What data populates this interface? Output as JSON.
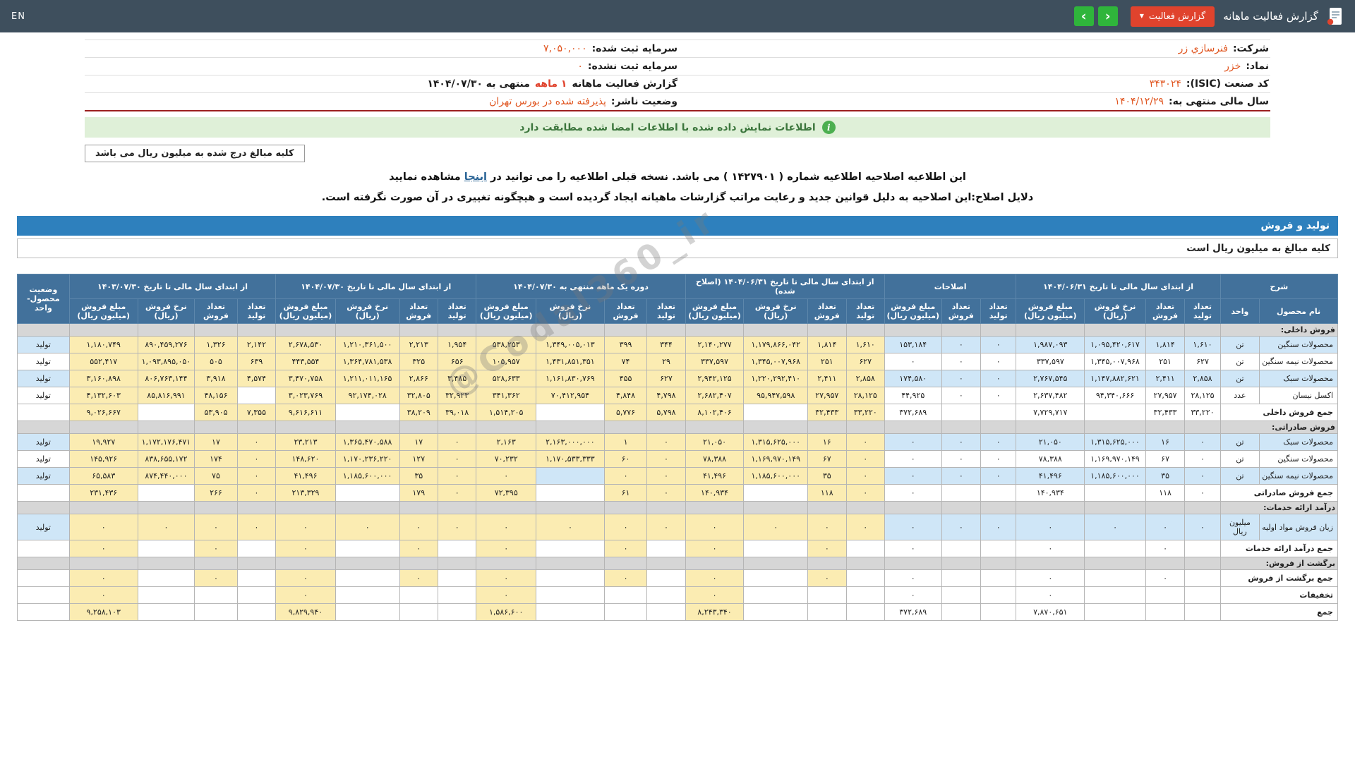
{
  "topbar": {
    "title": "گزارش فعالیت ماهانه",
    "report_button": "گزارش فعالیت",
    "nav_prev": "‹",
    "nav_next": "›",
    "lang": "EN"
  },
  "info": {
    "company_label": "شرکت:",
    "company": "فنرسازي زر",
    "symbol_label": "نماد:",
    "symbol": "خزر",
    "isic_label": "کد صنعت (ISIC):",
    "isic": "۳۴۳۰۲۴",
    "fiscal_label": "سال مالی منتهی به:",
    "fiscal": "۱۴۰۴/۱۲/۲۹",
    "cap_reg_label": "سرمایه ثبت شده:",
    "cap_reg": "۷,۰۵۰,۰۰۰",
    "cap_unreg_label": "سرمایه ثبت نشده:",
    "cap_unreg": "۰",
    "period_prefix": "گزارش فعالیت ماهانه",
    "period_highlight": "۱ ماهه",
    "period_suffix": "منتهی به ۱۴۰۴/۰۷/۳۰",
    "status_label": "وضعیت ناشر:",
    "status": "پذیرفته شده در بورس تهران"
  },
  "banner": {
    "text": "اطلاعات نمایش داده شده با اطلاعات امضا شده مطابقت دارد"
  },
  "amounts_note": "کلیه مبالغ درج شده به میلیون ریال می باشد",
  "notice": {
    "line1_a": "این اطلاعیه اصلاحیه اطلاعیه شماره ( ۱۴۲۷۹۰۱ ) می باشد. نسخه قبلی اطلاعیه را می توانید در",
    "line1_link": "اینجا",
    "line1_b": "مشاهده نمایید",
    "line2": "دلایل اصلاح:این اصلاحیه به دلیل قوانین جدید و رعایت مراتب گزارشات ماهیانه ایجاد گردیده است و هیچگونه تغییری در آن صورت نگرفته است."
  },
  "section_bar": "تولید و فروش",
  "table_note": "کلیه مبالغ به میلیون ریال است",
  "watermark": "@Codal360_ir",
  "table": {
    "desc_header": "شرح",
    "name_header": "نام محصول",
    "unit_header": "واحد",
    "status_header": "وضعیت محصول-واحد",
    "sub": {
      "prod": "تعداد تولید",
      "sold": "تعداد فروش",
      "rate": "نرخ فروش (ریال)",
      "amount": "مبلغ فروش (میلیون ریال)"
    },
    "groups": [
      {
        "key": "y0631",
        "label": "از ابتدای سال مالی تا تاریخ ۱۴۰۴/۰۶/۳۱",
        "cols": [
          "prod",
          "sold",
          "rate",
          "amount"
        ]
      },
      {
        "key": "amend",
        "label": "اصلاحات",
        "cols": [
          "prod",
          "sold",
          "amount"
        ]
      },
      {
        "key": "y0631a",
        "label": "از ابتدای سال مالی تا تاریخ ۱۴۰۴/۰۶/۳۱ (اصلاح شده)",
        "cols": [
          "prod",
          "sold",
          "rate",
          "amount"
        ]
      },
      {
        "key": "m1",
        "label": "دوره یک ماهه منتهی به ۱۴۰۴/۰۷/۳۰",
        "cols": [
          "prod",
          "sold",
          "rate",
          "amount"
        ]
      },
      {
        "key": "y0730",
        "label": "از ابتدای سال مالی تا تاریخ ۱۴۰۴/۰۷/۳۰",
        "cols": [
          "prod",
          "sold",
          "rate",
          "amount"
        ]
      },
      {
        "key": "prev",
        "label": "از ابتدای سال مالی تا تاریخ ۱۴۰۳/۰۷/۳۰",
        "cols": [
          "prod",
          "sold",
          "rate",
          "amount"
        ]
      }
    ],
    "rows": [
      {
        "kind": "section",
        "label": "فروش داخلی:"
      },
      {
        "kind": "item",
        "stripe": "b",
        "name": "محصولات سنگین",
        "unit": "تن",
        "status": "تولید",
        "y0631": [
          "۱,۶۱۰",
          "۱,۸۱۴",
          "۱,۰۹۵,۴۲۰,۶۱۷",
          "۱,۹۸۷,۰۹۳"
        ],
        "amend": [
          "۰",
          "۰",
          "۱۵۳,۱۸۴"
        ],
        "y0631a": [
          "۱,۶۱۰",
          "۱,۸۱۴",
          "۱,۱۷۹,۸۶۶,۰۴۲",
          "۲,۱۴۰,۲۷۷"
        ],
        "m1": [
          "۳۴۴",
          "۳۹۹",
          "۱,۳۴۹,۰۰۵,۰۱۳",
          "۵۳۸,۲۵۳"
        ],
        "y0730": [
          "۱,۹۵۴",
          "۲,۲۱۳",
          "۱,۲۱۰,۳۶۱,۵۰۰",
          "۲,۶۷۸,۵۳۰"
        ],
        "prev": [
          "۲,۱۴۲",
          "۱,۳۲۶",
          "۸۹۰,۴۵۹,۲۷۶",
          "۱,۱۸۰,۷۴۹"
        ]
      },
      {
        "kind": "item",
        "stripe": "w",
        "name": "محصولات نیمه سنگین",
        "unit": "تن",
        "status": "تولید",
        "y0631": [
          "۶۲۷",
          "۲۵۱",
          "۱,۳۴۵,۰۰۷,۹۶۸",
          "۳۳۷,۵۹۷"
        ],
        "amend": [
          "۰",
          "۰",
          "۰"
        ],
        "y0631a": [
          "۶۲۷",
          "۲۵۱",
          "۱,۳۴۵,۰۰۷,۹۶۸",
          "۳۳۷,۵۹۷"
        ],
        "m1": [
          "۲۹",
          "۷۴",
          "۱,۴۳۱,۸۵۱,۳۵۱",
          "۱۰۵,۹۵۷"
        ],
        "y0730": [
          "۶۵۶",
          "۳۲۵",
          "۱,۳۶۴,۷۸۱,۵۳۸",
          "۴۴۳,۵۵۴"
        ],
        "prev": [
          "۶۳۹",
          "۵۰۵",
          "۱,۰۹۳,۸۹۵,۰۵۰",
          "۵۵۲,۴۱۷"
        ]
      },
      {
        "kind": "item",
        "stripe": "b",
        "name": "محصولات سبک",
        "unit": "تن",
        "status": "تولید",
        "y0631": [
          "۲,۸۵۸",
          "۲,۴۱۱",
          "۱,۱۴۷,۸۸۲,۶۲۱",
          "۲,۷۶۷,۵۴۵"
        ],
        "amend": [
          "۰",
          "۰",
          "۱۷۴,۵۸۰"
        ],
        "y0631a": [
          "۲,۸۵۸",
          "۲,۴۱۱",
          "۱,۲۲۰,۲۹۲,۴۱۰",
          "۲,۹۴۲,۱۲۵"
        ],
        "m1": [
          "۶۲۷",
          "۴۵۵",
          "۱,۱۶۱,۸۳۰,۷۶۹",
          "۵۲۸,۶۳۳"
        ],
        "y0730": [
          "۳,۴۸۵",
          "۲,۸۶۶",
          "۱,۲۱۱,۰۱۱,۱۶۵",
          "۳,۴۷۰,۷۵۸"
        ],
        "prev": [
          "۴,۵۷۴",
          "۳,۹۱۸",
          "۸۰۶,۷۶۳,۱۴۴",
          "۳,۱۶۰,۸۹۸"
        ]
      },
      {
        "kind": "item",
        "stripe": "w",
        "name": "اکسل نیسان",
        "unit": "عدد",
        "status": "تولید",
        "y0631": [
          "۲۸,۱۲۵",
          "۲۷,۹۵۷",
          "۹۴,۳۴۰,۶۶۶",
          "۲,۶۳۷,۴۸۲"
        ],
        "amend": [
          "۰",
          "۰",
          "۴۴,۹۲۵"
        ],
        "y0631a": [
          "۲۸,۱۲۵",
          "۲۷,۹۵۷",
          "۹۵,۹۴۷,۵۹۸",
          "۲,۶۸۲,۴۰۷"
        ],
        "m1": [
          "۴,۷۹۸",
          "۴,۸۴۸",
          "۷۰,۴۱۲,۹۵۴",
          "۳۴۱,۳۶۲"
        ],
        "y0730": [
          "۳۲,۹۲۳",
          "۳۲,۸۰۵",
          "۹۲,۱۷۴,۰۲۸",
          "۳,۰۲۳,۷۶۹"
        ],
        "prev": [
          "",
          "۴۸,۱۵۶",
          "۸۵,۸۱۶,۹۹۱",
          "۴,۱۳۲,۶۰۳"
        ]
      },
      {
        "kind": "total",
        "stripe": "w",
        "label": "جمع فروش داخلی",
        "y0631": [
          "۳۳,۲۲۰",
          "۳۲,۴۳۳",
          "",
          "۷,۷۲۹,۷۱۷"
        ],
        "amend": [
          "",
          "",
          "۳۷۲,۶۸۹"
        ],
        "y0631a": [
          "۳۳,۲۲۰",
          "۳۲,۴۳۳",
          "",
          "۸,۱۰۲,۴۰۶"
        ],
        "m1": [
          "۵,۷۹۸",
          "۵,۷۷۶",
          "",
          "۱,۵۱۴,۲۰۵"
        ],
        "y0730": [
          "۳۹,۰۱۸",
          "۳۸,۲۰۹",
          "",
          "۹,۶۱۶,۶۱۱"
        ],
        "prev": [
          "۷,۳۵۵",
          "۵۳,۹۰۵",
          "",
          "۹,۰۲۶,۶۶۷"
        ]
      },
      {
        "kind": "section",
        "label": "فروش صادراتی:"
      },
      {
        "kind": "item",
        "stripe": "b",
        "name": "محصولات سبک",
        "unit": "تن",
        "status": "تولید",
        "y0631": [
          "۰",
          "۱۶",
          "۱,۳۱۵,۶۲۵,۰۰۰",
          "۲۱,۰۵۰"
        ],
        "amend": [
          "۰",
          "۰",
          "۰"
        ],
        "y0631a": [
          "۰",
          "۱۶",
          "۱,۳۱۵,۶۲۵,۰۰۰",
          "۲۱,۰۵۰"
        ],
        "m1": [
          "۰",
          "۱",
          "۲,۱۶۳,۰۰۰,۰۰۰",
          "۲,۱۶۳"
        ],
        "y0730": [
          "۰",
          "۱۷",
          "۱,۳۶۵,۴۷۰,۵۸۸",
          "۲۳,۲۱۳"
        ],
        "prev": [
          "۰",
          "۱۷",
          "۱,۱۷۲,۱۷۶,۴۷۱",
          "۱۹,۹۲۷"
        ]
      },
      {
        "kind": "item",
        "stripe": "w",
        "name": "محصولات سنگین",
        "unit": "تن",
        "status": "تولید",
        "y0631": [
          "۰",
          "۶۷",
          "۱,۱۶۹,۹۷۰,۱۴۹",
          "۷۸,۳۸۸"
        ],
        "amend": [
          "۰",
          "۰",
          "۰"
        ],
        "y0631a": [
          "۰",
          "۶۷",
          "۱,۱۶۹,۹۷۰,۱۴۹",
          "۷۸,۳۸۸"
        ],
        "m1": [
          "۰",
          "۶۰",
          "۱,۱۷۰,۵۳۳,۳۳۳",
          "۷۰,۲۳۲"
        ],
        "y0730": [
          "۰",
          "۱۲۷",
          "۱,۱۷۰,۲۳۶,۲۲۰",
          "۱۴۸,۶۲۰"
        ],
        "prev": [
          "۰",
          "۱۷۴",
          "۸۳۸,۶۵۵,۱۷۲",
          "۱۴۵,۹۲۶"
        ]
      },
      {
        "kind": "item",
        "stripe": "b",
        "name": "محصولات نیمه سنگین",
        "unit": "تن",
        "status": "تولید",
        "y0631": [
          "۰",
          "۳۵",
          "۱,۱۸۵,۶۰۰,۰۰۰",
          "۴۱,۴۹۶"
        ],
        "amend": [
          "۰",
          "۰",
          "۰"
        ],
        "y0631a": [
          "۰",
          "۳۵",
          "۱,۱۸۵,۶۰۰,۰۰۰",
          "۴۱,۴۹۶"
        ],
        "m1": [
          "۰",
          "۰",
          "",
          "۰"
        ],
        "y0730": [
          "۰",
          "۳۵",
          "۱,۱۸۵,۶۰۰,۰۰۰",
          "۴۱,۴۹۶"
        ],
        "prev": [
          "۰",
          "۷۵",
          "۸۷۴,۴۴۰,۰۰۰",
          "۶۵,۵۸۳"
        ]
      },
      {
        "kind": "total",
        "stripe": "w",
        "label": "جمع فروش صادراتی",
        "y0631": [
          "۰",
          "۱۱۸",
          "",
          "۱۴۰,۹۳۴"
        ],
        "amend": [
          "",
          "",
          "۰"
        ],
        "y0631a": [
          "۰",
          "۱۱۸",
          "",
          "۱۴۰,۹۳۴"
        ],
        "m1": [
          "۰",
          "۶۱",
          "",
          "۷۲,۳۹۵"
        ],
        "y0730": [
          "۰",
          "۱۷۹",
          "",
          "۲۱۳,۳۲۹"
        ],
        "prev": [
          "۰",
          "۲۶۶",
          "",
          "۲۳۱,۴۳۶"
        ]
      },
      {
        "kind": "section",
        "label": "درآمد ارائه خدمات:"
      },
      {
        "kind": "item",
        "stripe": "b",
        "name": "زیان فروش مواد اولیه",
        "unit": "میلیون ریال",
        "status": "تولید",
        "y0631": [
          "۰",
          "۰",
          "۰",
          "۰"
        ],
        "amend": [
          "۰",
          "۰",
          "۰"
        ],
        "y0631a": [
          "۰",
          "۰",
          "۰",
          "۰"
        ],
        "m1": [
          "۰",
          "۰",
          "۰",
          "۰"
        ],
        "y0730": [
          "۰",
          "۰",
          "۰",
          "۰"
        ],
        "prev": [
          "۰",
          "۰",
          "۰",
          "۰"
        ]
      },
      {
        "kind": "total",
        "stripe": "w",
        "label": "جمع درآمد ارائه خدمات",
        "y0631": [
          "",
          "۰",
          "",
          "۰"
        ],
        "amend": [
          "",
          "",
          "۰"
        ],
        "y0631a": [
          "",
          "۰",
          "",
          "۰"
        ],
        "m1": [
          "",
          "۰",
          "",
          "۰"
        ],
        "y0730": [
          "",
          "۰",
          "",
          "۰"
        ],
        "prev": [
          "",
          "۰",
          "",
          "۰"
        ]
      },
      {
        "kind": "section",
        "label": "برگشت از فروش:"
      },
      {
        "kind": "total",
        "stripe": "w",
        "label": "جمع برگشت از فروش",
        "y0631": [
          "",
          "۰",
          "",
          "۰"
        ],
        "amend": [
          "",
          "",
          "۰"
        ],
        "y0631a": [
          "",
          "۰",
          "",
          "۰"
        ],
        "m1": [
          "",
          "۰",
          "",
          "۰"
        ],
        "y0730": [
          "",
          "۰",
          "",
          "۰"
        ],
        "prev": [
          "",
          "۰",
          "",
          "۰"
        ]
      },
      {
        "kind": "total",
        "stripe": "w",
        "label": "تخفیفات",
        "y0631": [
          "",
          "",
          "",
          "۰"
        ],
        "amend": [
          "",
          "",
          "۰"
        ],
        "y0631a": [
          "",
          "",
          "",
          "۰"
        ],
        "m1": [
          "",
          "",
          "",
          "۰"
        ],
        "y0730": [
          "",
          "",
          "",
          "۰"
        ],
        "prev": [
          "",
          "",
          "",
          "۰"
        ]
      },
      {
        "kind": "grand",
        "stripe": "w",
        "label": "جمع",
        "y0631": [
          "",
          "",
          "",
          "۷,۸۷۰,۶۵۱"
        ],
        "amend": [
          "",
          "",
          "۳۷۲,۶۸۹"
        ],
        "y0631a": [
          "",
          "",
          "",
          "۸,۲۴۳,۳۴۰"
        ],
        "m1": [
          "",
          "",
          "",
          "۱,۵۸۶,۶۰۰"
        ],
        "y0730": [
          "",
          "",
          "",
          "۹,۸۲۹,۹۴۰"
        ],
        "prev": [
          "",
          "",
          "",
          "۹,۲۵۸,۱۰۳"
        ]
      }
    ]
  }
}
